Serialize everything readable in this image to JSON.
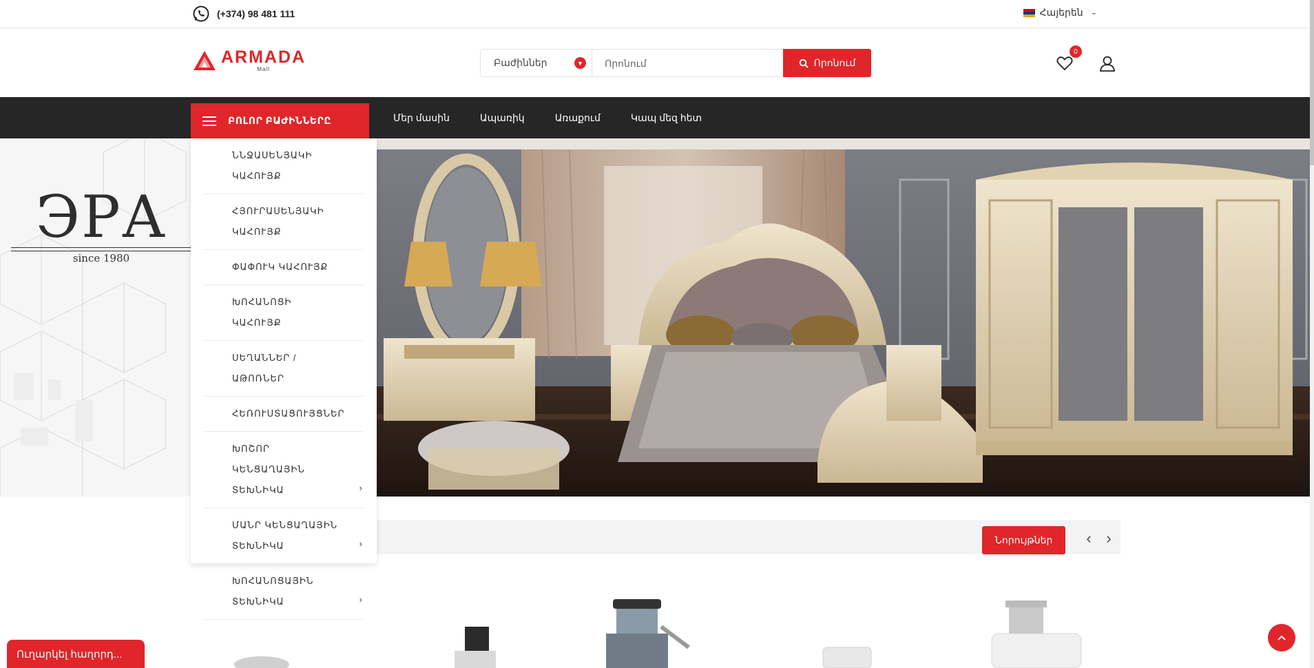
{
  "topbar": {
    "phone": "(+374) 98 481 111",
    "language": "Հայերեն"
  },
  "header": {
    "logo_text": "ARMADA",
    "logo_sub": "Mall",
    "category_select": "Բաժիններ",
    "search_placeholder": "Որոնում",
    "search_button": "Որոնում",
    "wishlist_count": "0"
  },
  "nav": {
    "all_categories": "ԲՈԼՈՐ ԲԱԺԻՆՆԵՐԸ",
    "links": [
      "Մեր մասին",
      "Ապառիկ",
      "Առաքում",
      "Կապ մեզ հետ"
    ]
  },
  "dropdown": {
    "items": [
      {
        "label": "ՆՆՋԱՍԵՆՅԱԿԻ ԿԱՀՈՒՅՔ",
        "has_submenu": false
      },
      {
        "label": "ՀՅՈՒՐԱՍԵՆՅԱԿԻ ԿԱՀՈՒՅՔ",
        "has_submenu": false
      },
      {
        "label": "ՓԱՓՈՒԿ ԿԱՀՈՒՅՔ",
        "has_submenu": false
      },
      {
        "label": "ԽՈՀԱՆՈՑԻ ԿԱՀՈՒՅՔ",
        "has_submenu": false
      },
      {
        "label": "ՍԵՂԱՆՆԵՐ / ԱԹՈՌՆԵՐ",
        "has_submenu": false
      },
      {
        "label": "ՀԵՌՈՒՍՏԱՑՈՒՅՑՆԵՐ",
        "has_submenu": false
      },
      {
        "label": "ԽՈՇՈՐ ԿԵՆՑԱՂԱՅԻՆ ՏԵԽՆԻԿԱ",
        "has_submenu": true
      },
      {
        "label": "ՄԱՆՐ ԿԵՆՑԱՂԱՅԻՆ ՏԵԽՆԻԿԱ",
        "has_submenu": true
      },
      {
        "label": "ԽՈՀԱՆՈՑԱՅԻՆ ՏԵԽՆԻԿԱ",
        "has_submenu": true
      }
    ]
  },
  "hero": {
    "brand_word": "ЭРА",
    "brand_since": "since 1980"
  },
  "products": {
    "tab_label": "Նորույթներ"
  },
  "chat": {
    "label": "Ուղարկել հաղորդ..."
  },
  "colors": {
    "accent": "#e0262a",
    "navbar": "#262626"
  }
}
